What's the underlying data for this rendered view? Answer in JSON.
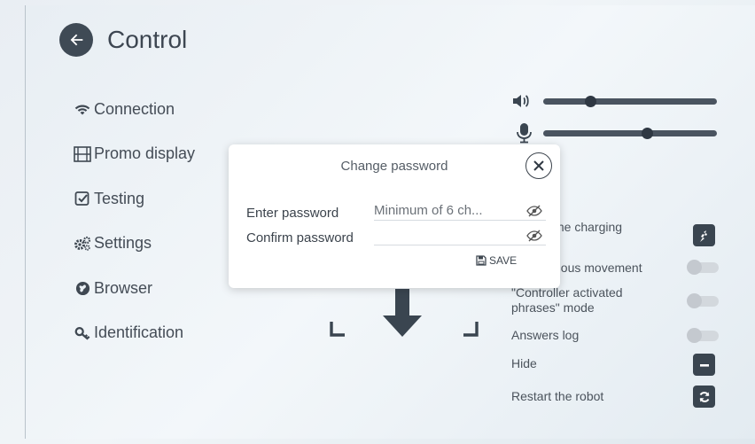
{
  "header": {
    "title": "Control"
  },
  "menu": [
    {
      "label": "Connection",
      "icon": "wifi-icon"
    },
    {
      "label": "Promo display",
      "icon": "film-icon"
    },
    {
      "label": "Testing",
      "icon": "checkbox-icon"
    },
    {
      "label": "Settings",
      "icon": "gears-icon"
    },
    {
      "label": "Browser",
      "icon": "globe-icon"
    },
    {
      "label": "Identification",
      "icon": "key-icon"
    }
  ],
  "sliders": {
    "volume": {
      "icon": "speaker-icon",
      "level": 0.27
    },
    "microphone": {
      "icon": "microphone-icon",
      "level": 0.6
    }
  },
  "options": {
    "charging": "the charging",
    "autonomous": "nous movement",
    "phrases": "\"Controller activated phrases\" mode",
    "answers": "Answers log",
    "hide": "Hide",
    "restart": "Restart the robot"
  },
  "dialog": {
    "title": "Change password",
    "enter_label": "Enter password",
    "enter_placeholder": "Minimum of 6 ch...",
    "confirm_label": "Confirm password",
    "confirm_value": "",
    "save_label": "SAVE"
  },
  "colors": {
    "dark": "#3a4550",
    "accent": "#2f3843",
    "background": "#eef3f7"
  }
}
